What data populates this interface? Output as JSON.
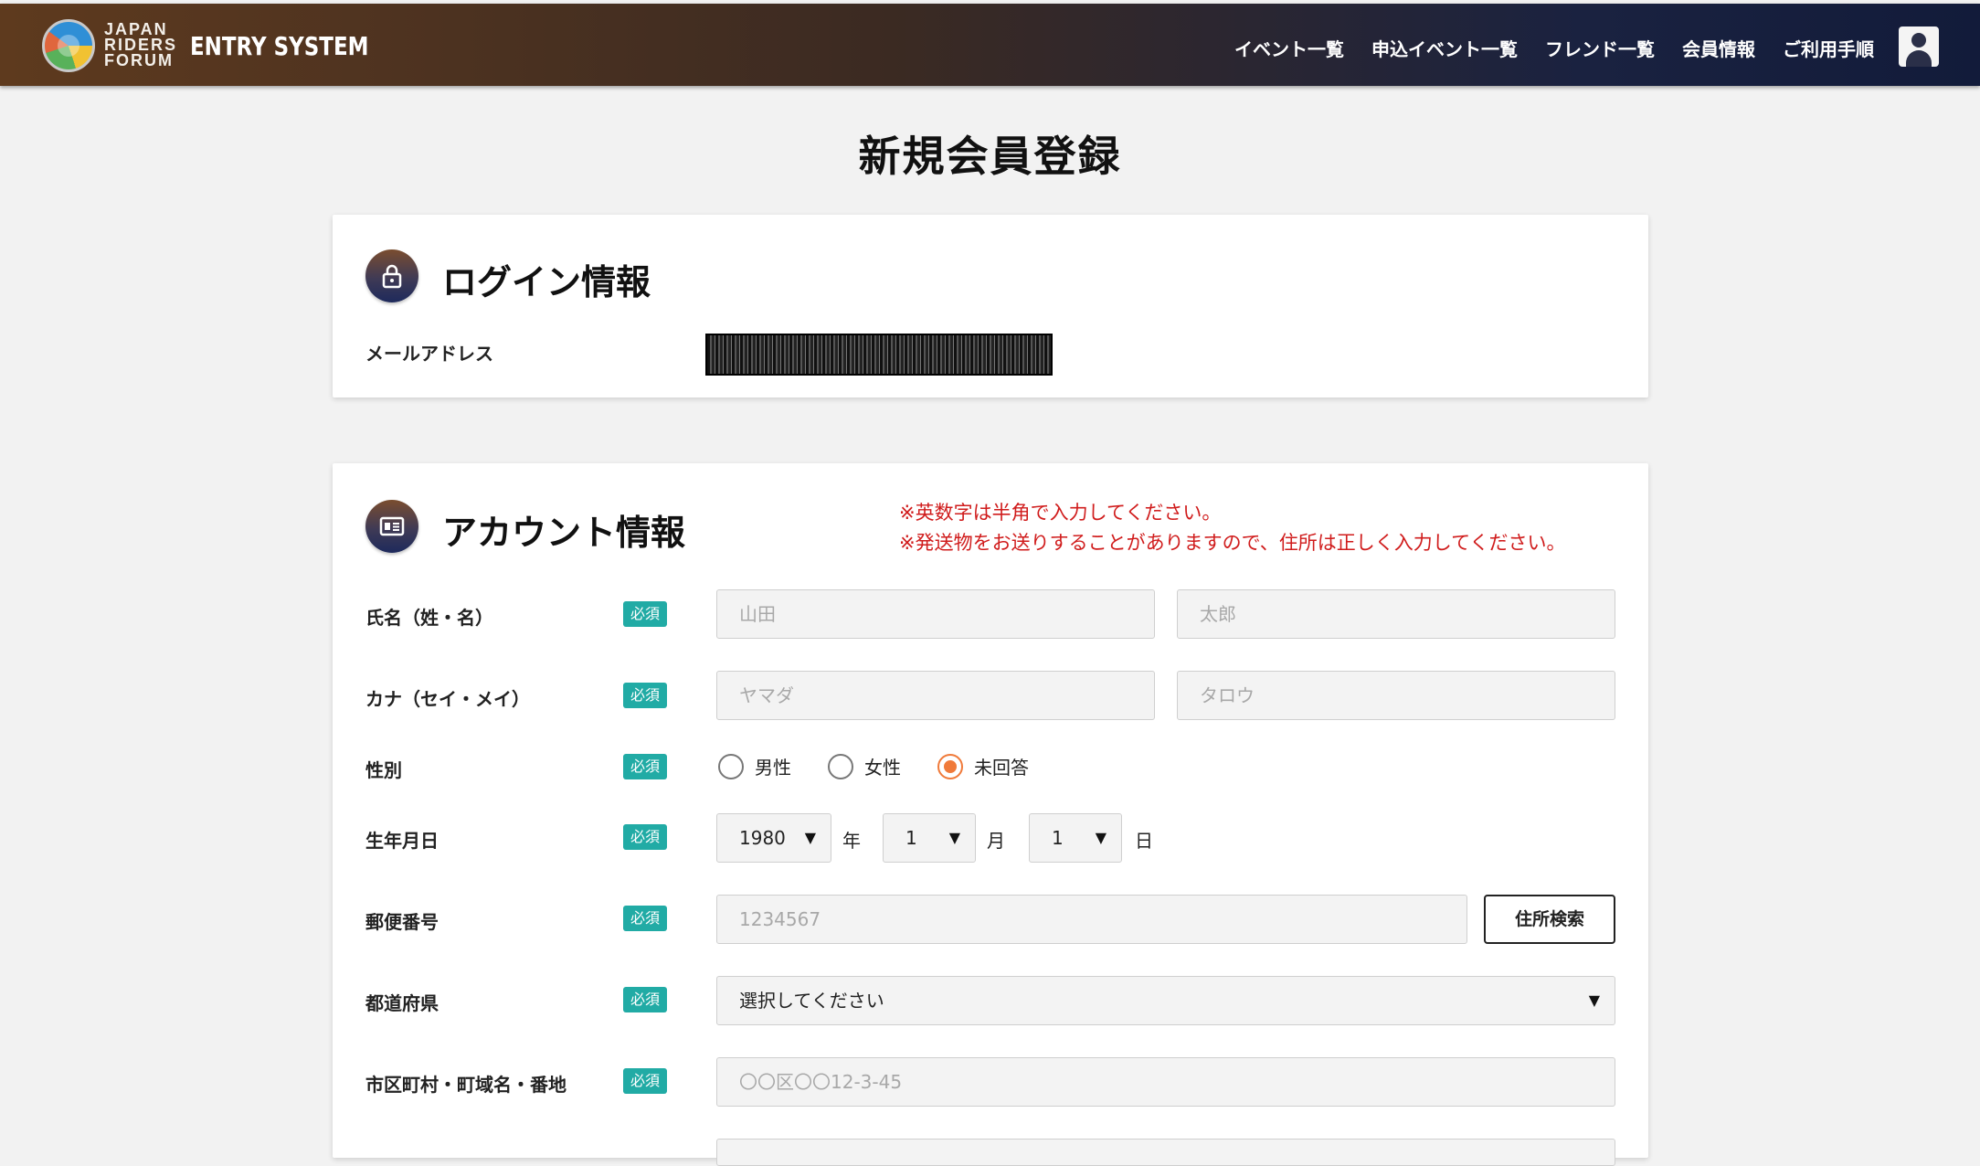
{
  "header": {
    "logo_lines": [
      "JAPAN",
      "RIDERS",
      "FORUM"
    ],
    "app_name": "ENTRY SYSTEM",
    "nav": [
      "イベント一覧",
      "申込イベント一覧",
      "フレンド一覧",
      "会員情報",
      "ご利用手順"
    ]
  },
  "page": {
    "title": "新規会員登録"
  },
  "login_section": {
    "title": "ログイン情報",
    "email_label": "メールアドレス"
  },
  "account_section": {
    "title": "アカウント情報",
    "notices": [
      "※英数字は半角で入力してください。",
      "※発送物をお送りすることがありますので、住所は正しく入力してください。"
    ],
    "required_badge": "必須",
    "name": {
      "label": "氏名（姓・名）",
      "last_placeholder": "山田",
      "first_placeholder": "太郎"
    },
    "kana": {
      "label": "カナ（セイ・メイ）",
      "last_placeholder": "ヤマダ",
      "first_placeholder": "タロウ"
    },
    "gender": {
      "label": "性別",
      "options": [
        "男性",
        "女性",
        "未回答"
      ],
      "selected": "未回答"
    },
    "birthday": {
      "label": "生年月日",
      "year": "1980",
      "year_unit": "年",
      "month": "1",
      "month_unit": "月",
      "day": "1",
      "day_unit": "日"
    },
    "postal": {
      "label": "郵便番号",
      "placeholder": "1234567",
      "search_button": "住所検索"
    },
    "prefecture": {
      "label": "都道府県",
      "value": "選択してください"
    },
    "address": {
      "label": "市区町村・町域名・番地",
      "placeholder": "〇〇区〇〇12-3-45"
    }
  },
  "colors": {
    "required": "#21aba5",
    "notice": "#d01c1c",
    "radio_checked": "#f07a3a"
  }
}
